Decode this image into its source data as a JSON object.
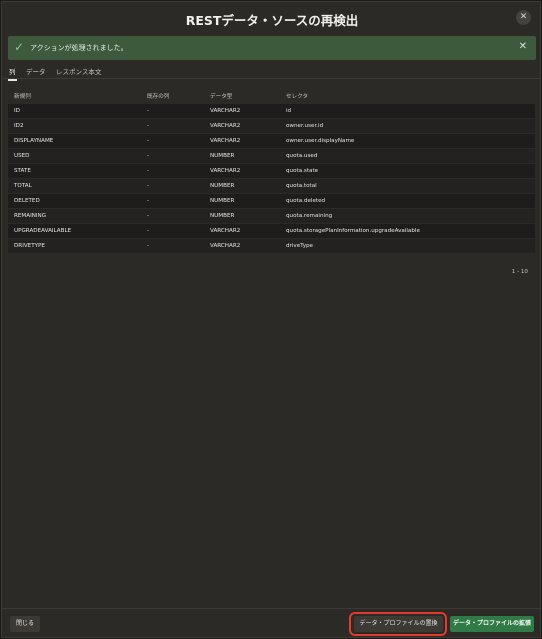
{
  "dialog": {
    "title": "RESTデータ・ソースの再検出",
    "close_icon": "✕"
  },
  "alert": {
    "icon": "✓",
    "message": "アクションが処理されました。",
    "close_icon": "✕",
    "color": "#3d5a3d"
  },
  "tabs": [
    {
      "label": "列",
      "active": true
    },
    {
      "label": "データ",
      "active": false
    },
    {
      "label": "レスポンス本文",
      "active": false
    }
  ],
  "table": {
    "headers": [
      "新規列",
      "既存の列",
      "データ型",
      "セレクタ"
    ],
    "rows": [
      [
        "ID",
        "-",
        "VARCHAR2",
        "id"
      ],
      [
        "ID2",
        "-",
        "VARCHAR2",
        "owner.user.id"
      ],
      [
        "DISPLAYNAME",
        "-",
        "VARCHAR2",
        "owner.user.displayName"
      ],
      [
        "USED",
        "-",
        "NUMBER",
        "quota.used"
      ],
      [
        "STATE",
        "-",
        "VARCHAR2",
        "quota.state"
      ],
      [
        "TOTAL",
        "-",
        "NUMBER",
        "quota.total"
      ],
      [
        "DELETED",
        "-",
        "NUMBER",
        "quota.deleted"
      ],
      [
        "REMAINING",
        "-",
        "NUMBER",
        "quota.remaining"
      ],
      [
        "UPGRADEAVAILABLE",
        "-",
        "VARCHAR2",
        "quota.storagePlanInformation.upgradeAvailable"
      ],
      [
        "DRIVETYPE",
        "-",
        "VARCHAR2",
        "driveType"
      ]
    ],
    "pagination": "1 - 10"
  },
  "footer": {
    "close_label": "閉じる",
    "replace_label": "データ・プロファイルの置換",
    "extend_label": "データ・プロファイルの拡張",
    "accent_color": "#2f7a45",
    "highlight_color": "#e23b2a"
  }
}
